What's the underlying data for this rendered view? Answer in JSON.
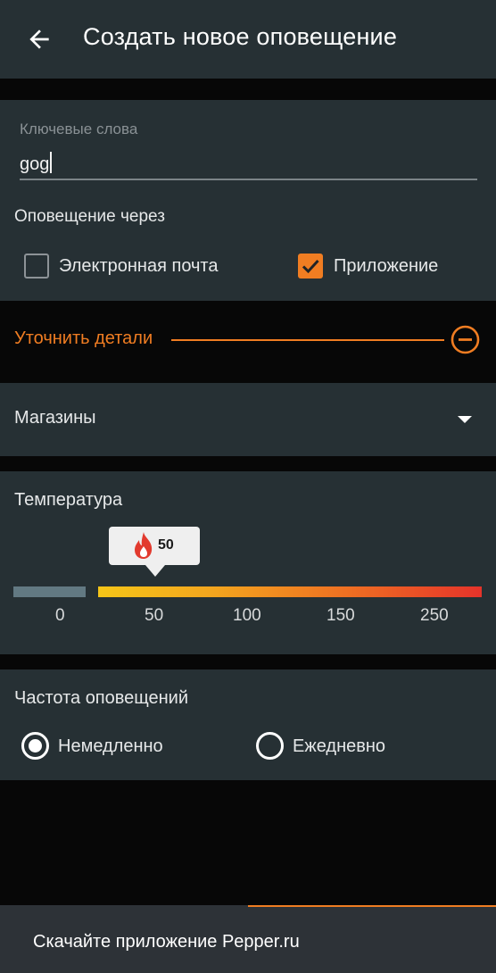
{
  "header": {
    "title": "Создать новое оповещение",
    "back_icon": "arrow-left-icon"
  },
  "keywords": {
    "label": "Ключевые слова",
    "value": "gog"
  },
  "notify_via": {
    "label": "Оповещение через",
    "options": [
      {
        "label": "Электронная почта",
        "checked": false
      },
      {
        "label": "Приложение",
        "checked": true
      }
    ]
  },
  "refine": {
    "label": "Уточнить детали",
    "icon": "minus-circle-icon"
  },
  "stores": {
    "label": "Магазины",
    "icon": "caret-down-icon"
  },
  "temperature": {
    "label": "Температура",
    "selected_value": "50",
    "ticks": [
      "0",
      "50",
      "100",
      "150",
      "250"
    ],
    "icon": "flame-icon"
  },
  "frequency": {
    "label": "Частота оповещений",
    "options": [
      {
        "label": "Немедленно",
        "selected": true
      },
      {
        "label": "Ежедневно",
        "selected": false
      }
    ]
  },
  "banner": {
    "text": "Скачайте приложение Pepper.ru"
  },
  "colors": {
    "accent": "#f07d22",
    "card_bg": "#263034",
    "page_bg": "#070707"
  }
}
